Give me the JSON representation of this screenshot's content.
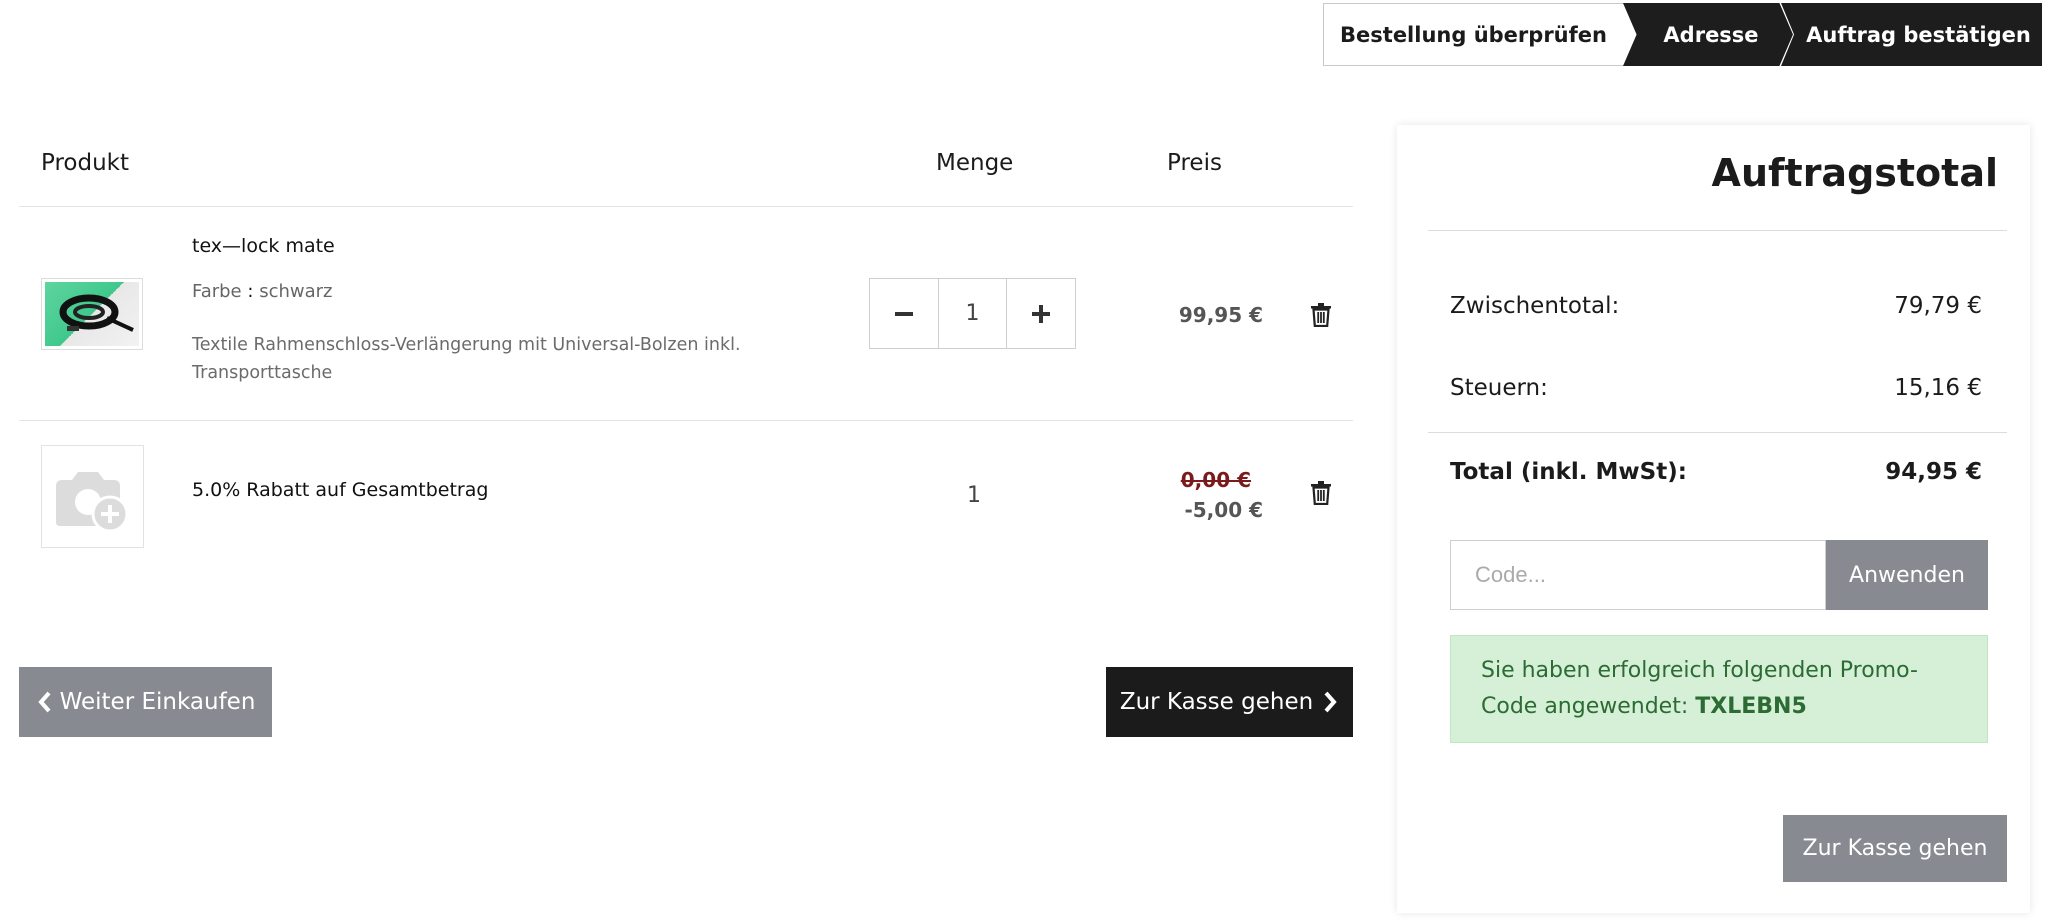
{
  "steps": [
    {
      "label": "Bestellung überprüfen"
    },
    {
      "label": "Adresse"
    },
    {
      "label": "Auftrag bestätigen"
    }
  ],
  "cart": {
    "headers": {
      "product": "Produkt",
      "quantity": "Menge",
      "price": "Preis"
    },
    "items": [
      {
        "name": "tex—lock mate",
        "attribute_label": "Farbe",
        "attribute_sep": ":",
        "attribute_value": "schwarz",
        "description": "Textile Rahmenschloss-Verlängerung mit Universal-Bolzen inkl. Transporttasche",
        "quantity": "1",
        "price": "99,95 €"
      },
      {
        "name": "5.0% Rabatt auf Gesamtbetrag",
        "quantity": "1",
        "price_old": "0,00 €",
        "price": "-5,00 €"
      }
    ],
    "continue_label": "Weiter Einkaufen",
    "checkout_label": "Zur Kasse gehen"
  },
  "summary": {
    "title": "Auftragstotal",
    "subtotal_label": "Zwischentotal:",
    "subtotal_value": "79,79 €",
    "tax_label": "Steuern:",
    "tax_value": "15,16 €",
    "total_label": "Total (inkl. MwSt):",
    "total_value": "94,95 €",
    "promo_placeholder": "Code...",
    "apply_label": "Anwenden",
    "promo_message": "Sie haben erfolgreich folgenden Promo-Code angewendet:",
    "promo_code": "TXLEBN5",
    "checkout_label": "Zur Kasse gehen"
  },
  "colors": {
    "dark": "#1d1d1d",
    "gray_button": "#878b91",
    "success_bg": "#d5f0d7",
    "success_text": "#2c6b33",
    "old_price": "#7a1b1b"
  }
}
